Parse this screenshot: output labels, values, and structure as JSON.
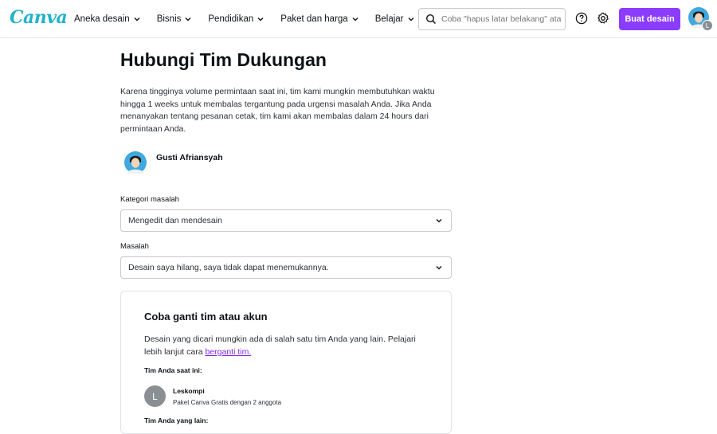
{
  "header": {
    "logo": "Canva",
    "nav": [
      {
        "label": "Aneka desain"
      },
      {
        "label": "Bisnis"
      },
      {
        "label": "Pendidikan"
      },
      {
        "label": "Paket dan harga"
      },
      {
        "label": "Belajar"
      }
    ],
    "search_placeholder": "Coba \"hapus latar belakang\" ata",
    "cta_label": "Buat desain",
    "account_badge": "L",
    "colors": {
      "accent": "#8b3dff",
      "logo": "#21b3c9"
    }
  },
  "page": {
    "title": "Hubungi Tim Dukungan",
    "intro": "Karena tingginya volume permintaan saat ini, tim kami mungkin membutuhkan waktu hingga 1 weeks untuk membalas tergantung pada urgensi masalah Anda. Jika Anda menanyakan tentang pesanan cetak, tim kami akan membalas dalam 24 hours dari permintaan Anda.",
    "user_name": "Gusti Afriansyah"
  },
  "form": {
    "category_label": "Kategori masalah",
    "category_value": "Mengedit dan mendesain",
    "issue_label": "Masalah",
    "issue_value": "Desain saya hilang, saya tidak dapat menemukannya."
  },
  "card": {
    "title": "Coba ganti tim atau akun",
    "desc_prefix": "Desain yang dicari mungkin ada di salah satu tim Anda yang lain. Pelajari lebih lanjut cara ",
    "desc_link": "berganti tim.",
    "current_team_label": "Tim Anda saat ini:",
    "team_initial": "L",
    "team_name": "Leskompi",
    "team_plan": "Paket Canva Gratis dengan 2 anggota",
    "next_label": "Tim Anda yang lain:"
  }
}
